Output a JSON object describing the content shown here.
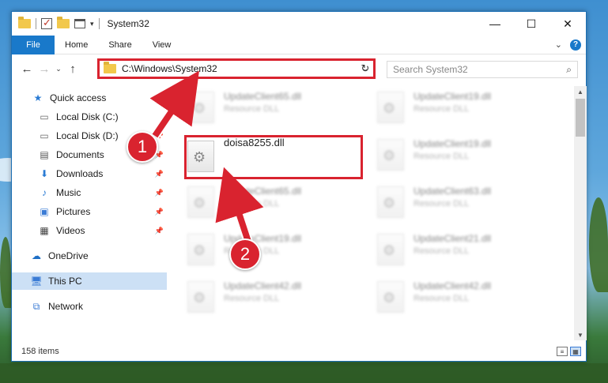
{
  "window": {
    "title": "System32",
    "controls": {
      "minimize": "—",
      "maximize": "☐",
      "close": "✕"
    }
  },
  "ribbon": {
    "file": "File",
    "tabs": [
      "Home",
      "Share",
      "View"
    ],
    "expand": "⌄",
    "help": "?"
  },
  "address": {
    "path": "C:\\Windows\\System32",
    "chevron": "⌄",
    "refresh": "↻",
    "nav": {
      "back": "←",
      "forward": "→",
      "recent": "⌄",
      "up": "↑"
    }
  },
  "search": {
    "placeholder": "Search System32",
    "icon": "search-icon"
  },
  "nav_pane": {
    "items": [
      {
        "label": "Quick access",
        "icon": "star-icon"
      },
      {
        "label": "Local Disk (C:)",
        "icon": "drive-icon"
      },
      {
        "label": "Local Disk (D:)",
        "icon": "drive-icon"
      },
      {
        "label": "Documents",
        "icon": "documents-icon"
      },
      {
        "label": "Downloads",
        "icon": "downloads-icon"
      },
      {
        "label": "Music",
        "icon": "music-icon"
      },
      {
        "label": "Pictures",
        "icon": "pictures-icon"
      },
      {
        "label": "Videos",
        "icon": "videos-icon"
      },
      {
        "label": "OneDrive",
        "icon": "cloud-icon"
      },
      {
        "label": "This PC",
        "icon": "computer-icon"
      },
      {
        "label": "Network",
        "icon": "network-icon"
      }
    ]
  },
  "files": {
    "highlighted": {
      "name": "doisa8255.dll"
    },
    "background": [
      {
        "name": "UpdateClient65.dll",
        "type": "Resource DLL"
      },
      {
        "name": "UpdateClient19.dll",
        "type": "Resource DLL"
      },
      {
        "name": "UpdateClient19.dll",
        "type": "Resource DLL"
      },
      {
        "name": "UpdateClient65.dll",
        "type": "Resource DLL"
      },
      {
        "name": "UpdateClient63.dll",
        "type": "Resource DLL"
      },
      {
        "name": "UpdateClient19.dll",
        "type": "Resource DLL"
      },
      {
        "name": "UpdateClient21.dll",
        "type": "Resource DLL"
      },
      {
        "name": "UpdateClient42.dll",
        "type": "Resource DLL"
      },
      {
        "name": "UpdateClient42.dll",
        "type": "Resource DLL"
      }
    ]
  },
  "status": {
    "count": "158 items"
  },
  "annotations": {
    "badge1": "1",
    "badge2": "2",
    "color": "#d9232f"
  }
}
